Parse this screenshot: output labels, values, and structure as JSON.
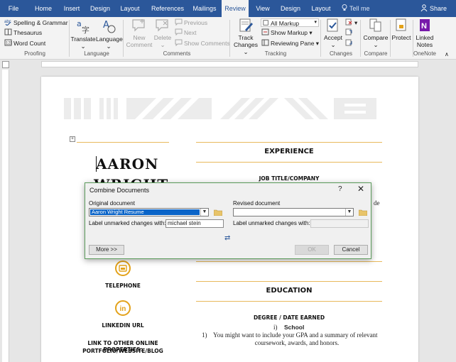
{
  "tabs": [
    "File",
    "Home",
    "Insert",
    "Design",
    "Layout",
    "References",
    "Mailings",
    "Review",
    "View",
    "Design",
    "Layout"
  ],
  "active_tab": "Review",
  "tell_me": "Tell me",
  "share": "Share",
  "ribbon": {
    "proofing": {
      "spelling": "Spelling & Grammar",
      "thesaurus": "Thesaurus",
      "word_count": "Word Count",
      "label": "Proofing"
    },
    "language": {
      "translate": "Translate",
      "language": "Language",
      "label": "Language"
    },
    "comments": {
      "new_comment": "New Comment",
      "new_comment_line1": "New",
      "new_comment_line2": "Comment",
      "delete": "Delete",
      "previous": "Previous",
      "next": "Next",
      "show_comments": "Show Comments",
      "label": "Comments"
    },
    "tracking": {
      "track_line1": "Track",
      "track_line2": "Changes",
      "markup_select": "All Markup",
      "show_markup": "Show Markup",
      "reviewing_pane": "Reviewing Pane",
      "label": "Tracking"
    },
    "changes": {
      "accept": "Accept",
      "label": "Changes"
    },
    "compare": {
      "compare": "Compare",
      "label": "Compare"
    },
    "protect": {
      "protect": "Protect"
    },
    "onenote": {
      "linked_line1": "Linked",
      "linked_line2": "Notes",
      "label": "OneNote"
    }
  },
  "document": {
    "name_line1": "AARON",
    "name_line2": "WRIGHT",
    "experience": "EXPERIENCE",
    "job_title": "JOB TITLE/COMPANY",
    "trailing_fragment": "de",
    "telephone": "TELEPHONE",
    "linkedin": "LINKEDIN URL",
    "link_other_line1": "LINK TO OTHER ONLINE PROPERTIES:",
    "link_other_line2": "PORTFOLIO/WEBSITE/BLOG",
    "education": "EDUCATION",
    "degree": "DEGREE / DATE EARNED",
    "school_marker": "i)",
    "school": "School",
    "gpa_marker": "1)",
    "gpa_line1": "You might want to include your GPA and a summary of relevant",
    "gpa_line2": "coursework, awards, and honors."
  },
  "dialog": {
    "title": "Combine Documents",
    "help": "?",
    "close": "✕",
    "original_label": "Original document",
    "original_value": "Aaron Wright Resume",
    "original_unmarked_label": "Label unmarked changes with:",
    "original_unmarked_value": "michael stein",
    "revised_label": "Revised document",
    "revised_value": "",
    "revised_unmarked_label": "Label unmarked changes with:",
    "revised_unmarked_value": "",
    "swap": "⇄",
    "more": "More >>",
    "ok": "OK",
    "cancel": "Cancel"
  },
  "colors": {
    "ribbon_blue": "#2b579a",
    "accent_orange": "#e3a21a",
    "dialog_border": "#5b9b5b",
    "selection_blue": "#0a64c8"
  }
}
